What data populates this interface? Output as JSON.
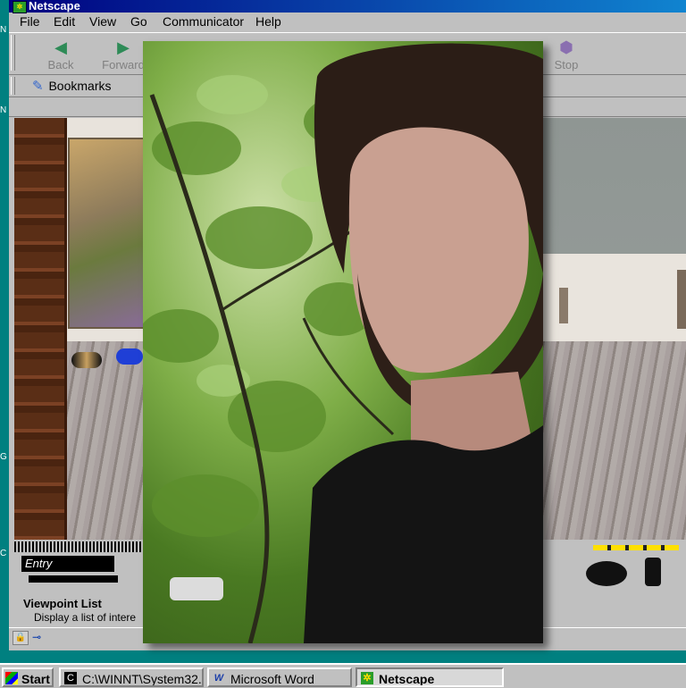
{
  "window": {
    "title": "Netscape"
  },
  "menu": {
    "items": [
      "File",
      "Edit",
      "View",
      "Go",
      "Communicator",
      "Help"
    ]
  },
  "toolbar": {
    "back_label": "Back",
    "forward_label": "Forward",
    "stop_label": "Stop"
  },
  "bookmarks": {
    "label": "Bookmarks"
  },
  "viewpoint": {
    "entry_label": "Entry",
    "list_title": "Viewpoint List",
    "list_desc": "Display a list of intere"
  },
  "taskbar": {
    "start_label": "Start",
    "tasks": [
      "C:\\WINNT\\System32...",
      "Microsoft Word",
      "Netscape"
    ]
  },
  "desktop": {
    "left_letters": [
      "N",
      "N",
      "G",
      "C"
    ]
  },
  "colors": {
    "desktop": "#008080",
    "titlebar": "#000080",
    "chrome": "#c0c0c0"
  }
}
